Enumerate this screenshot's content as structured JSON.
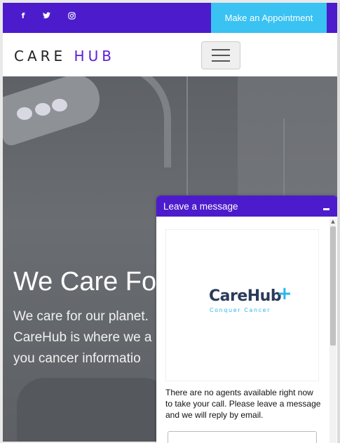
{
  "topbar": {
    "social": [
      {
        "name": "facebook",
        "glyph": "f"
      },
      {
        "name": "twitter",
        "glyph": "🐦"
      },
      {
        "name": "instagram",
        "glyph": "◎"
      }
    ],
    "appointment_label": "Make an Appointment"
  },
  "nav": {
    "brand_part1": "CARE",
    "brand_part2": "HUB"
  },
  "hero": {
    "title": "We Care Fo",
    "lines": [
      "We care for our planet.",
      "CareHub is where we a",
      "you cancer informatio"
    ]
  },
  "chat": {
    "title": "Leave a message",
    "logo_name": "CareHub",
    "logo_plus": "+",
    "logo_tagline": "Conquer Cancer",
    "message": "There are no agents available right now to take your call. Please leave a message and we will reply by email."
  },
  "colors": {
    "accent_purple": "#4c1ccc",
    "button_cyan": "#39c2f2",
    "brand_purple": "#5a20d6"
  }
}
